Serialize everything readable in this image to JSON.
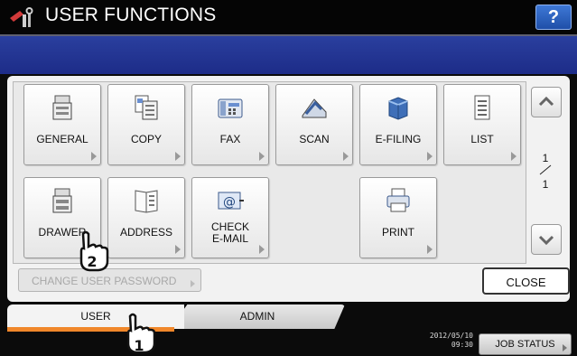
{
  "header": {
    "title": "USER FUNCTIONS",
    "help_label": "?"
  },
  "functions": [
    {
      "label": "GENERAL",
      "icon": "general-icon"
    },
    {
      "label": "COPY",
      "icon": "copy-icon"
    },
    {
      "label": "FAX",
      "icon": "fax-icon"
    },
    {
      "label": "SCAN",
      "icon": "scan-icon"
    },
    {
      "label": "E-FILING",
      "icon": "e-filing-icon"
    },
    {
      "label": "LIST",
      "icon": "list-icon"
    },
    {
      "label": "DRAWER",
      "icon": "drawer-icon"
    },
    {
      "label": "ADDRESS",
      "icon": "address-book-icon"
    },
    {
      "label": "CHECK\nE-MAIL",
      "icon": "check-email-icon"
    },
    {
      "label": "PRINT",
      "icon": "printer-icon"
    }
  ],
  "pagination": {
    "current": "1",
    "total": "1"
  },
  "actions": {
    "change_password": "CHANGE USER PASSWORD",
    "close": "CLOSE"
  },
  "tabs": [
    {
      "label": "USER",
      "active": true
    },
    {
      "label": "ADMIN",
      "active": false
    }
  ],
  "status": {
    "date": "2012/05/10",
    "time": "09:30",
    "job_status": "JOB STATUS"
  },
  "callouts": [
    {
      "label": "1",
      "icon": "pointing-hand-icon"
    },
    {
      "label": "2",
      "icon": "pointing-hand-icon"
    }
  ]
}
